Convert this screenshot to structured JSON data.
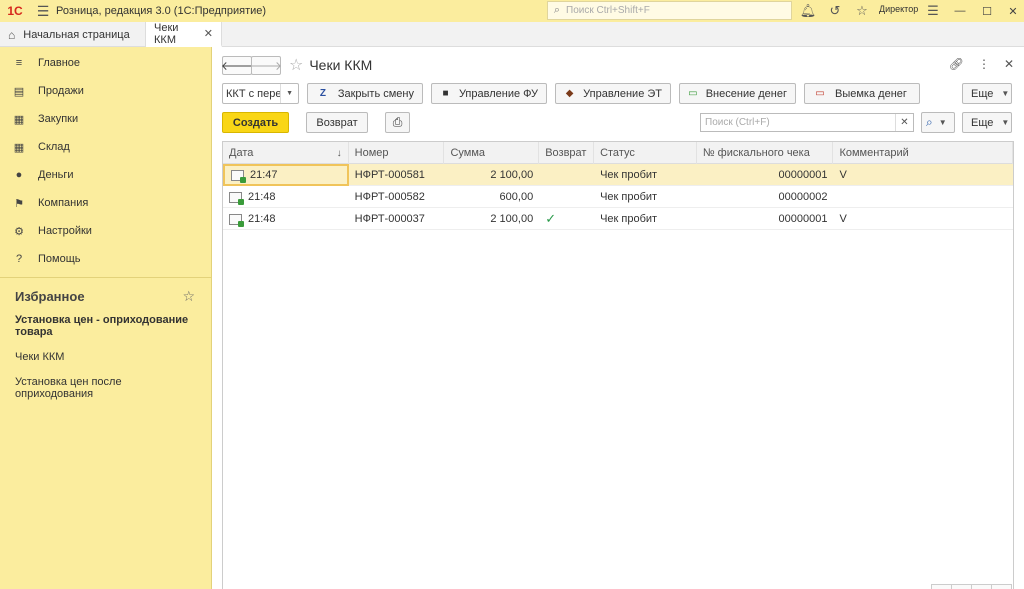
{
  "app": {
    "logo": "1С",
    "title": "Розница, редакция 3.0  (1С:Предприятие)",
    "search_placeholder": "Поиск Ctrl+Shift+F",
    "user": "Директор"
  },
  "tabs": [
    {
      "label": "Начальная страница"
    },
    {
      "label": "Чеки ККМ"
    }
  ],
  "sidebar": {
    "items": [
      {
        "label": "Главное",
        "icon": "menu-icon"
      },
      {
        "label": "Продажи",
        "icon": "cash-register-icon"
      },
      {
        "label": "Закупки",
        "icon": "cart-icon"
      },
      {
        "label": "Склад",
        "icon": "warehouse-icon"
      },
      {
        "label": "Деньги",
        "icon": "coin-icon"
      },
      {
        "label": "Компания",
        "icon": "flag-icon"
      },
      {
        "label": "Настройки",
        "icon": "gear-icon"
      },
      {
        "label": "Помощь",
        "icon": "help-icon"
      }
    ],
    "favorites_title": "Избранное",
    "favorites": [
      {
        "label": "Установка цен - оприходование товара",
        "bold": true
      },
      {
        "label": "Чеки ККМ",
        "bold": false
      },
      {
        "label": "Установка цен после оприходования",
        "bold": false
      }
    ]
  },
  "form": {
    "title": "Чеки ККМ",
    "kkt_combo": "ККТ с пере",
    "buttons": {
      "close_shift": "Закрыть смену",
      "fu_manage": "Управление ФУ",
      "et_manage": "Управление ЭТ",
      "cash_in": "Внесение денег",
      "cash_out": "Выемка денег",
      "more": "Еще",
      "create": "Создать",
      "return": "Возврат"
    },
    "search_placeholder": "Поиск (Ctrl+F)",
    "colors": {
      "accent": "#f9d616",
      "sidebar": "#fbed9e",
      "selected_row": "#fbf0c4",
      "check": "#2a9a4a"
    }
  },
  "table": {
    "columns": [
      "Дата",
      "Номер",
      "Сумма",
      "Возврат",
      "Статус",
      "№ фискального чека",
      "Комментарий"
    ],
    "rows": [
      {
        "date": "21:47",
        "number": "НФРТ-000581",
        "sum": "2 100,00",
        "return": false,
        "status": "Чек пробит",
        "fiscal": "00000001",
        "comment": "V"
      },
      {
        "date": "21:48",
        "number": "НФРТ-000582",
        "sum": "600,00",
        "return": false,
        "status": "Чек пробит",
        "fiscal": "00000002",
        "comment": ""
      },
      {
        "date": "21:48",
        "number": "НФРТ-000037",
        "sum": "2 100,00",
        "return": true,
        "status": "Чек пробит",
        "fiscal": "00000001",
        "comment": "V"
      }
    ]
  }
}
